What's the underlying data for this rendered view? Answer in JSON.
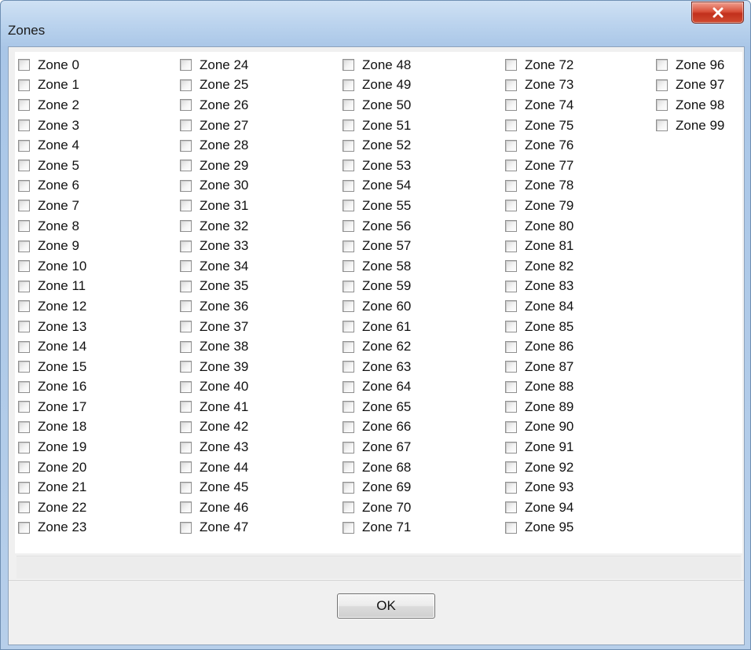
{
  "window": {
    "title": "Zones",
    "close_icon": "close-icon",
    "accent_close": "#c8402a"
  },
  "zones": [
    "Zone 0",
    "Zone 1",
    "Zone 2",
    "Zone 3",
    "Zone 4",
    "Zone 5",
    "Zone 6",
    "Zone 7",
    "Zone 8",
    "Zone 9",
    "Zone 10",
    "Zone 11",
    "Zone 12",
    "Zone 13",
    "Zone 14",
    "Zone 15",
    "Zone 16",
    "Zone 17",
    "Zone 18",
    "Zone 19",
    "Zone 20",
    "Zone 21",
    "Zone 22",
    "Zone 23",
    "Zone 24",
    "Zone 25",
    "Zone 26",
    "Zone 27",
    "Zone 28",
    "Zone 29",
    "Zone 30",
    "Zone 31",
    "Zone 32",
    "Zone 33",
    "Zone 34",
    "Zone 35",
    "Zone 36",
    "Zone 37",
    "Zone 38",
    "Zone 39",
    "Zone 40",
    "Zone 41",
    "Zone 42",
    "Zone 43",
    "Zone 44",
    "Zone 45",
    "Zone 46",
    "Zone 47",
    "Zone 48",
    "Zone 49",
    "Zone 50",
    "Zone 51",
    "Zone 52",
    "Zone 53",
    "Zone 54",
    "Zone 55",
    "Zone 56",
    "Zone 57",
    "Zone 58",
    "Zone 59",
    "Zone 60",
    "Zone 61",
    "Zone 62",
    "Zone 63",
    "Zone 64",
    "Zone 65",
    "Zone 66",
    "Zone 67",
    "Zone 68",
    "Zone 69",
    "Zone 70",
    "Zone 71",
    "Zone 72",
    "Zone 73",
    "Zone 74",
    "Zone 75",
    "Zone 76",
    "Zone 77",
    "Zone 78",
    "Zone 79",
    "Zone 80",
    "Zone 81",
    "Zone 82",
    "Zone 83",
    "Zone 84",
    "Zone 85",
    "Zone 86",
    "Zone 87",
    "Zone 88",
    "Zone 89",
    "Zone 90",
    "Zone 91",
    "Zone 92",
    "Zone 93",
    "Zone 94",
    "Zone 95",
    "Zone 96",
    "Zone 97",
    "Zone 98",
    "Zone 99"
  ],
  "footer": {
    "ok_label": "OK"
  }
}
